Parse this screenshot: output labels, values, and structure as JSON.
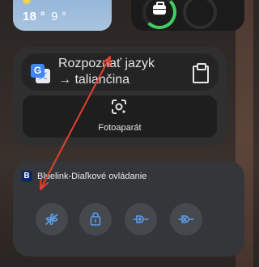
{
  "weather": {
    "temp_high": "18 °",
    "temp_low": "9 °",
    "icon": "sun-icon"
  },
  "translate_widget": {
    "input_text": "Rozpoznať jazyk",
    "target_text": "→ taliančina",
    "camera_label": "Fotoaparát",
    "logo_letter": "G",
    "logo_back_letter": "文"
  },
  "bluelink_widget": {
    "title": "Bluelink-Diaľkové ovládanie",
    "logo_letter": "B",
    "buttons": [
      {
        "name": "climate-fan-button",
        "icon": "fan-icon"
      },
      {
        "name": "lock-button",
        "icon": "lock-icon"
      },
      {
        "name": "charge-start-button",
        "icon": "plug-icon"
      },
      {
        "name": "charge-stop-button",
        "icon": "plug-off-icon"
      }
    ]
  },
  "annotation": {
    "color": "#e4402f"
  }
}
